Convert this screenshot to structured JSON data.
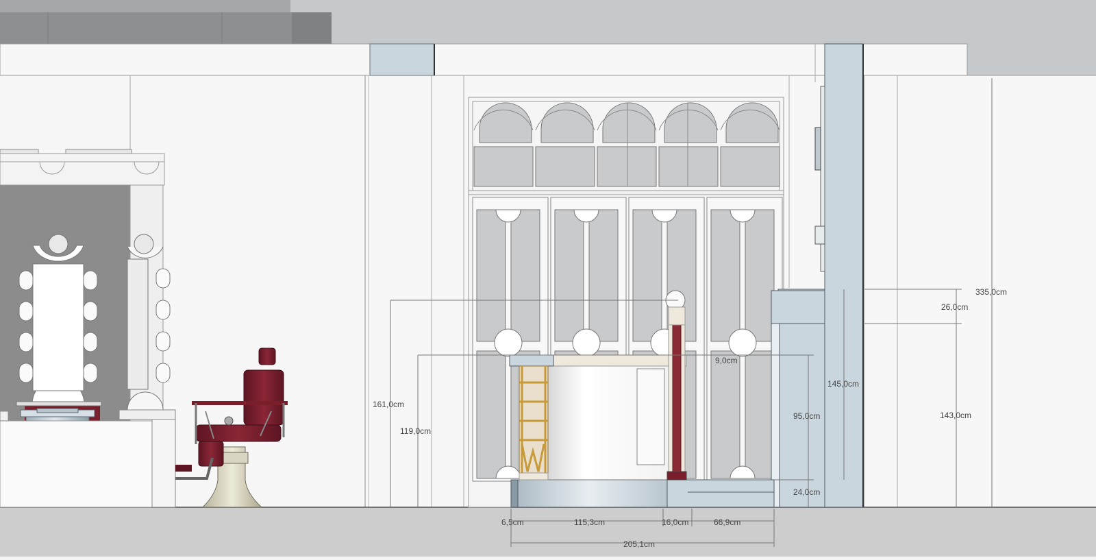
{
  "drawing": {
    "vertical_dimensions": [
      {
        "label": "335,0cm"
      },
      {
        "label": "26,0cm"
      },
      {
        "label": "143,0cm"
      },
      {
        "label": "145,0cm"
      },
      {
        "label": "161,0cm"
      },
      {
        "label": "119,0cm"
      },
      {
        "label": "95,0cm"
      },
      {
        "label": "24,0cm"
      },
      {
        "label": "9,0cm"
      }
    ],
    "horizontal_dimensions": [
      {
        "label": "6,5cm"
      },
      {
        "label": "115,3cm"
      },
      {
        "label": "16,0cm"
      },
      {
        "label": "66,9cm"
      },
      {
        "label": "205,1cm"
      }
    ],
    "colors": {
      "wall": "#f7f7f7",
      "line": "#8c8c8c",
      "glass": "#c8cacb",
      "blue_grey": "#c9d6de",
      "burgundy": "#7a1e2c",
      "marble": "#efe8dc",
      "gold": "#c79a3a",
      "floor": "#cdcdcd",
      "ceiling": "#c6c9cc"
    }
  }
}
